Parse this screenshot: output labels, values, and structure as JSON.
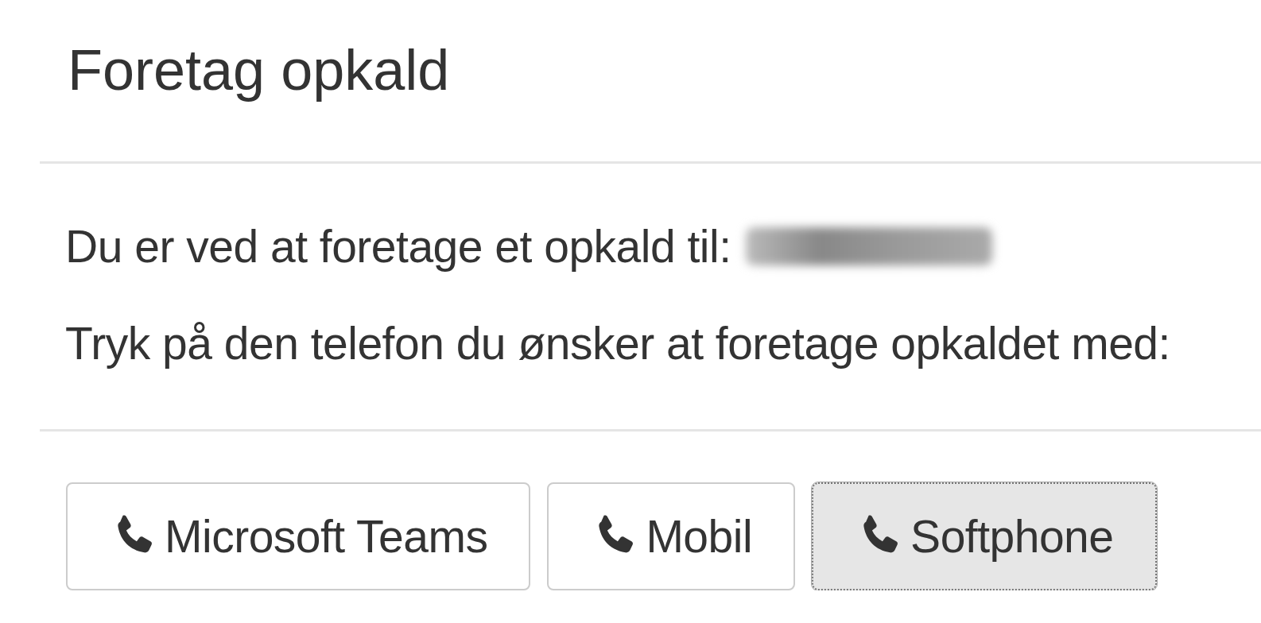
{
  "dialog": {
    "title": "Foretag opkald",
    "messages": [
      {
        "text": "Du er ved at foretage et opkald til:",
        "redacted_value": true
      },
      {
        "text": "Tryk på den telefon du ønsker at foretage opkaldet med:",
        "redacted_value": false
      }
    ],
    "buttons": [
      {
        "label": "Microsoft Teams",
        "selected": false
      },
      {
        "label": "Mobil",
        "selected": false
      },
      {
        "label": "Softphone",
        "selected": true
      }
    ]
  }
}
